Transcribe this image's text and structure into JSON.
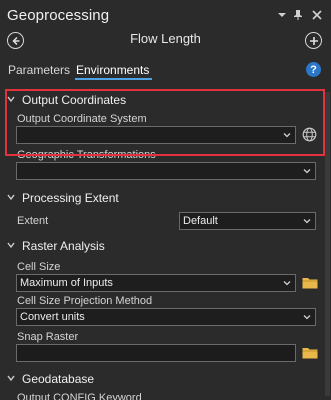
{
  "panel": {
    "title": "Geoprocessing",
    "tool_name": "Flow Length",
    "tabs": [
      "Parameters",
      "Environments"
    ],
    "active_tab": "Environments",
    "help_label": "?"
  },
  "sections": {
    "output_coordinates": {
      "title": "Output Coordinates",
      "system_label": "Output Coordinate System",
      "system_value": "",
      "transform_label": "Geographic Transformations",
      "transform_value": ""
    },
    "processing_extent": {
      "title": "Processing Extent",
      "extent_label": "Extent",
      "extent_value": "Default"
    },
    "raster_analysis": {
      "title": "Raster Analysis",
      "cell_size_label": "Cell Size",
      "cell_size_value": "Maximum of Inputs",
      "projection_label": "Cell Size Projection Method",
      "projection_value": "Convert units",
      "snap_label": "Snap Raster",
      "snap_value": ""
    },
    "geodatabase": {
      "title": "Geodatabase",
      "config_label": "Output CONFIG Keyword"
    }
  },
  "colors": {
    "highlight": "#e2333d",
    "accent": "#4fa3e3",
    "help": "#2b76c9",
    "folder": "#e8b84a"
  },
  "icons": [
    "dropdown-menu-icon",
    "pin-icon",
    "close-icon",
    "back-icon",
    "add-icon",
    "help-icon",
    "globe-icon",
    "folder-icon",
    "chevron-down-icon"
  ]
}
